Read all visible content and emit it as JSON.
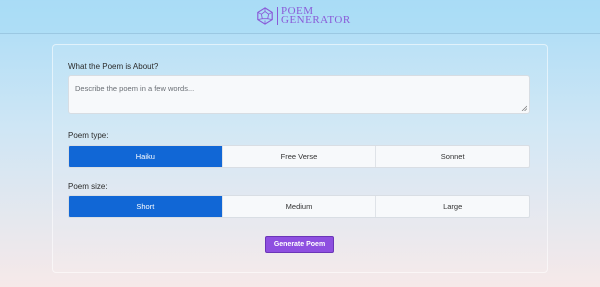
{
  "header": {
    "logo_line1": "POEM",
    "logo_line2": "GENERATOR",
    "logo_icon": "dodecahedron-icon",
    "logo_color": "#8a5bd8"
  },
  "form": {
    "topic_label": "What the Poem is About?",
    "topic_placeholder": "Describe the poem in a few words...",
    "topic_value": "",
    "type_label": "Poem type:",
    "type_options": [
      "Haiku",
      "Free Verse",
      "Sonnet"
    ],
    "type_selected": "Haiku",
    "size_label": "Poem size:",
    "size_options": [
      "Short",
      "Medium",
      "Large"
    ],
    "size_selected": "Short",
    "submit_label": "Generate Poem"
  },
  "colors": {
    "active_option": "#1167d6",
    "submit_button": "#8e4fe0"
  }
}
